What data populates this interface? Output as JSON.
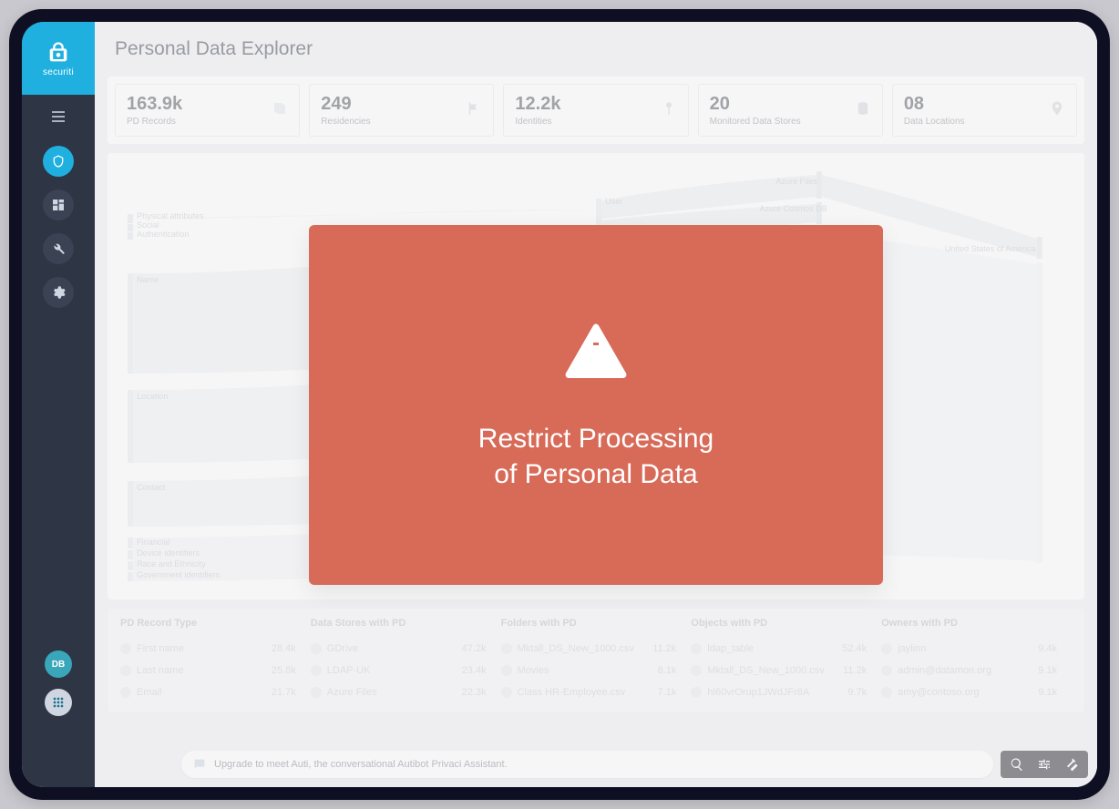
{
  "brand": {
    "name": "securiti"
  },
  "header": {
    "title": "Personal Data Explorer"
  },
  "sidebar": {
    "avatar_initials": "DB"
  },
  "stats": [
    {
      "value": "163.9k",
      "label": "PD Records"
    },
    {
      "value": "249",
      "label": "Residencies"
    },
    {
      "value": "12.2k",
      "label": "Identities"
    },
    {
      "value": "20",
      "label": "Monitored Data Stores"
    },
    {
      "value": "08",
      "label": "Data Locations"
    }
  ],
  "sankey": {
    "left_labels": [
      "Physical attributes",
      "Social",
      "Authentication",
      "Name",
      "Location",
      "Contact",
      "Financial",
      "Device identifiers",
      "Race and Ethnicity",
      "Government identifiers"
    ],
    "mid_label": "User",
    "right_labels": [
      "Azure Files",
      "Azure Cosmos DB"
    ],
    "far_right_label": "United States of America"
  },
  "table": {
    "columns": [
      "PD Record Type",
      "Data Stores with PD",
      "Folders with PD",
      "Objects with PD",
      "Owners with PD"
    ],
    "rows": [
      {
        "c0": "First name",
        "n0": "28.4k",
        "c1": "GDrive",
        "n1": "47.2k",
        "c2": "Mktall_DS_New_1000.csv",
        "n2": "11.2k",
        "c3": "ldap_table",
        "n3": "52.4k",
        "c4": "jaylinn",
        "n4": "9.4k"
      },
      {
        "c0": "Last name",
        "n0": "25.8k",
        "c1": "LDAP-UK",
        "n1": "23.4k",
        "c2": "Movies",
        "n2": "8.1k",
        "c3": "Mktall_DS_New_1000.csv",
        "n3": "11.2k",
        "c4": "admin@datamon.org",
        "n4": "9.1k"
      },
      {
        "c0": "Email",
        "n0": "21.7k",
        "c1": "Azure Files",
        "n1": "22.3k",
        "c2": "Class HR-Employee.csv",
        "n2": "7.1k",
        "c3": "hl60vrOrup1JWdJFr8A",
        "n3": "9.7k",
        "c4": "amy@contoso.org",
        "n4": "9.1k"
      }
    ]
  },
  "footer": {
    "auti_text": "Upgrade to meet Auti, the conversational Autibot Privaci Assistant."
  },
  "modal": {
    "color": "#d86a58",
    "line1": "Restrict Processing",
    "line2": "of Personal Data"
  }
}
